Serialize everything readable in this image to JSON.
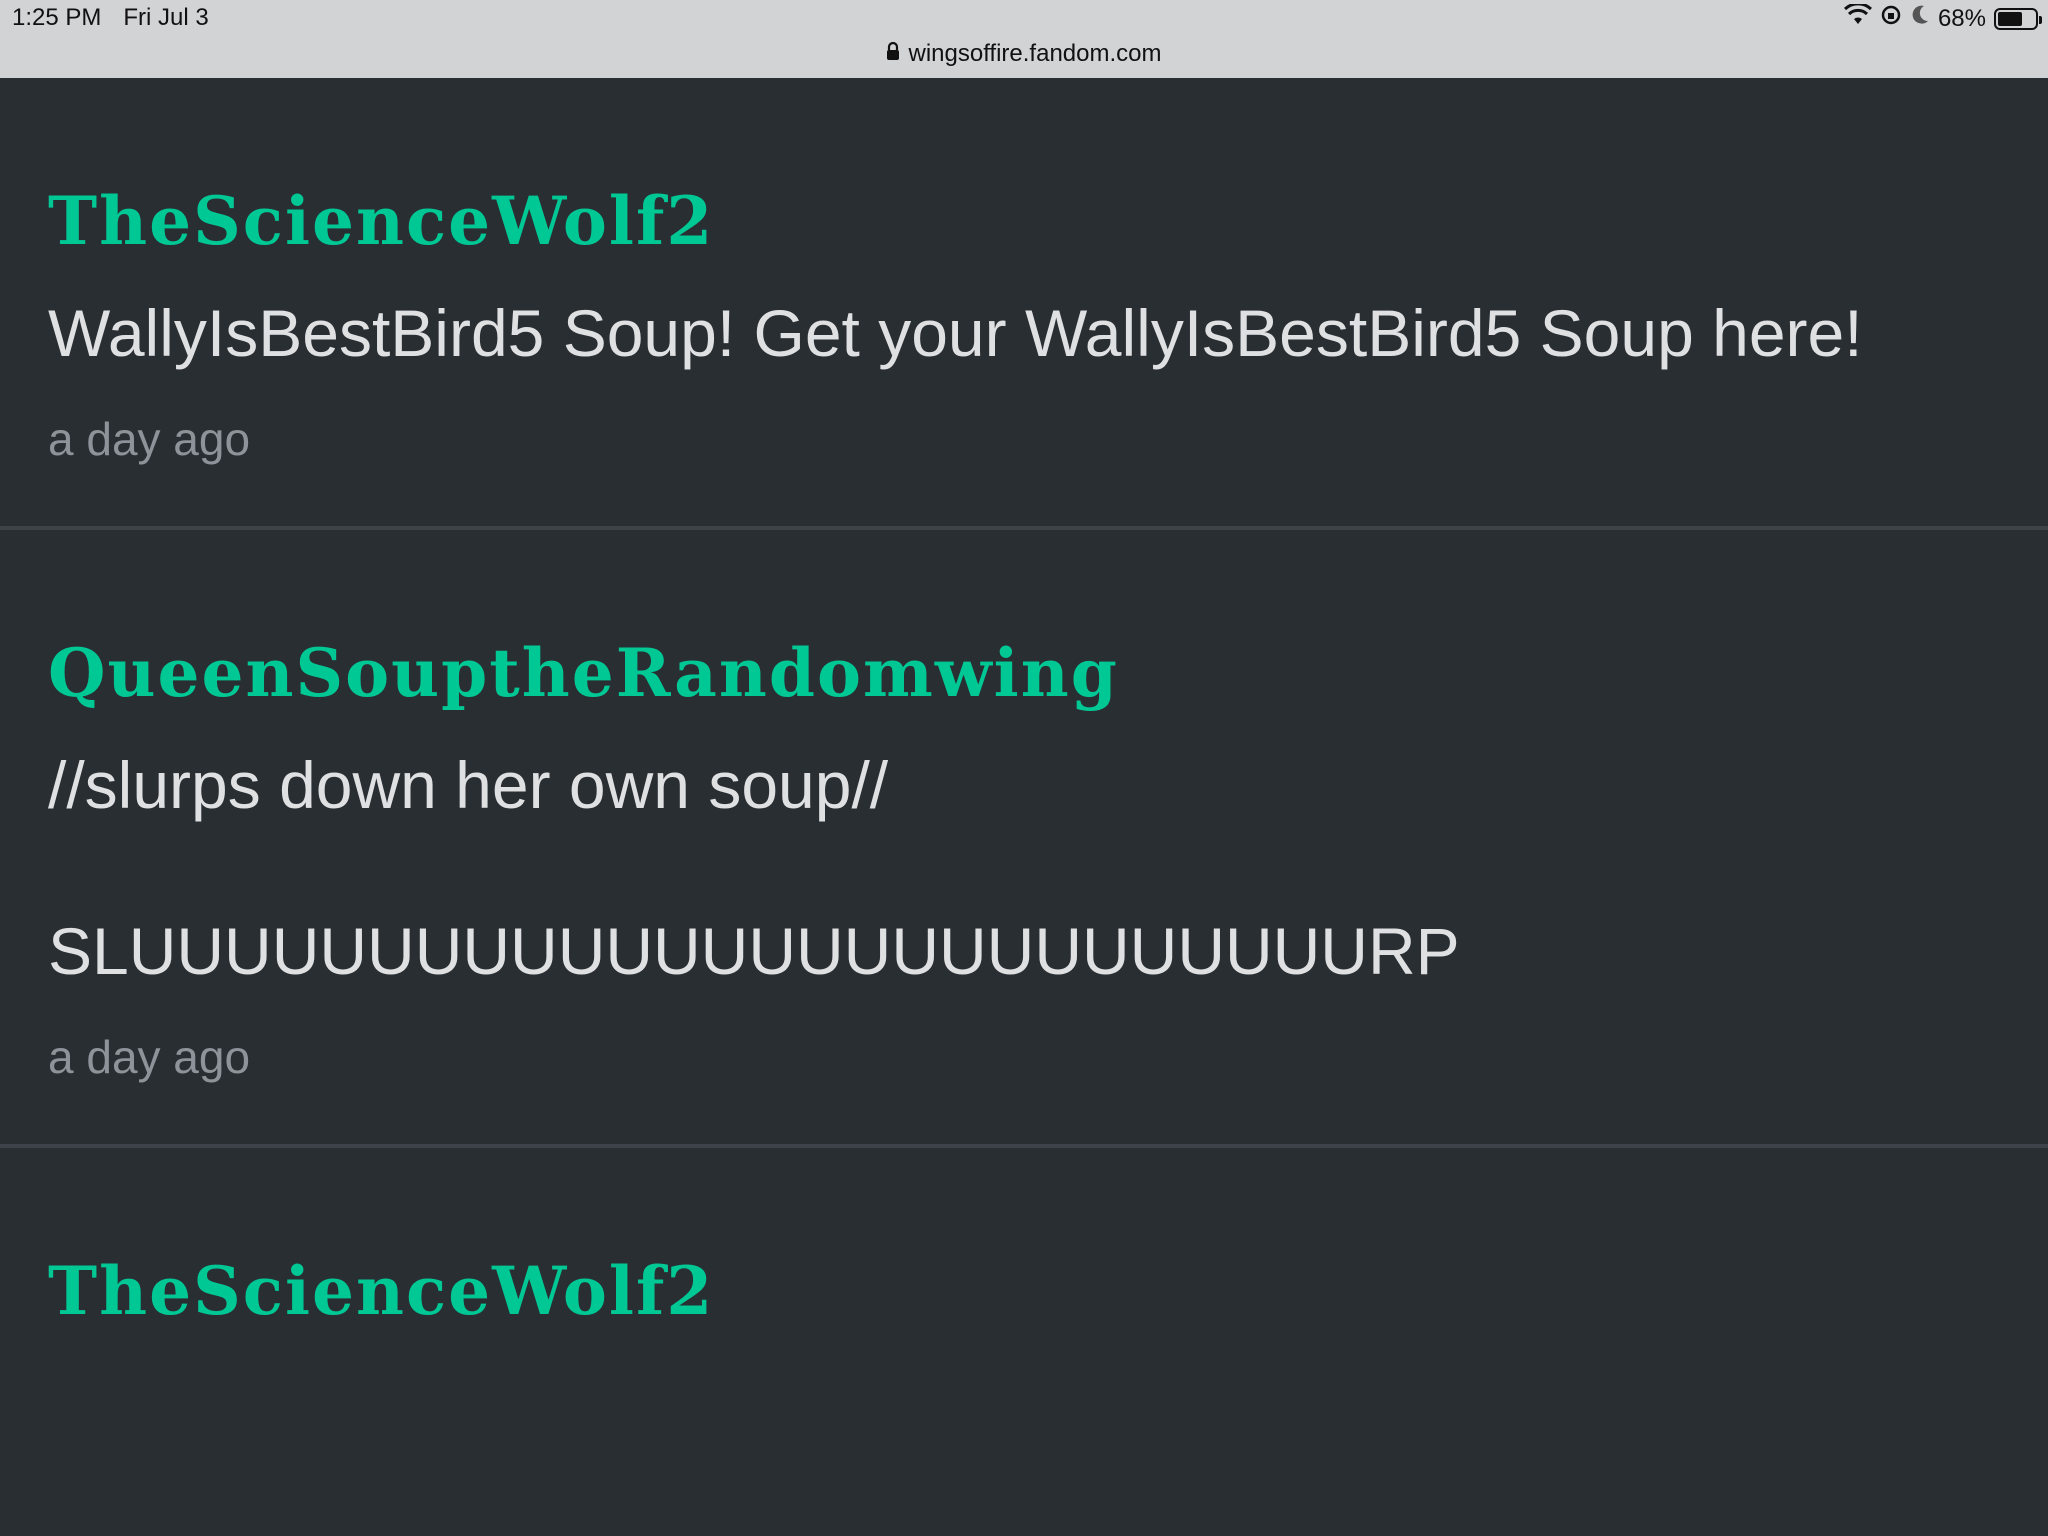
{
  "status_bar": {
    "time": "1:25 PM",
    "date": "Fri Jul 3",
    "battery_text": "68%",
    "battery_level": 0.68,
    "url": "wingsoffire.fandom.com",
    "icons": [
      "wifi-icon",
      "orientation-lock-icon",
      "moon-icon",
      "battery-icon",
      "lock-icon"
    ]
  },
  "colors": {
    "background": "#292e33",
    "author": "#00c895",
    "text": "#dfe0e2",
    "muted": "#8e9399"
  },
  "comments": [
    {
      "author": "TheScienceWolf2",
      "lines": [
        "WallyIsBestBird5 Soup! Get your WallyIsBestBird5 Soup here!"
      ],
      "time": "a day ago"
    },
    {
      "author": "QueenSouptheRandomwing",
      "lines": [
        "//slurps down her own soup//",
        "SLUUUUUUUUUUUUUUUUUUUUUUUUUURP"
      ],
      "time": "a day ago"
    },
    {
      "author": "TheScienceWolf2"
    }
  ]
}
